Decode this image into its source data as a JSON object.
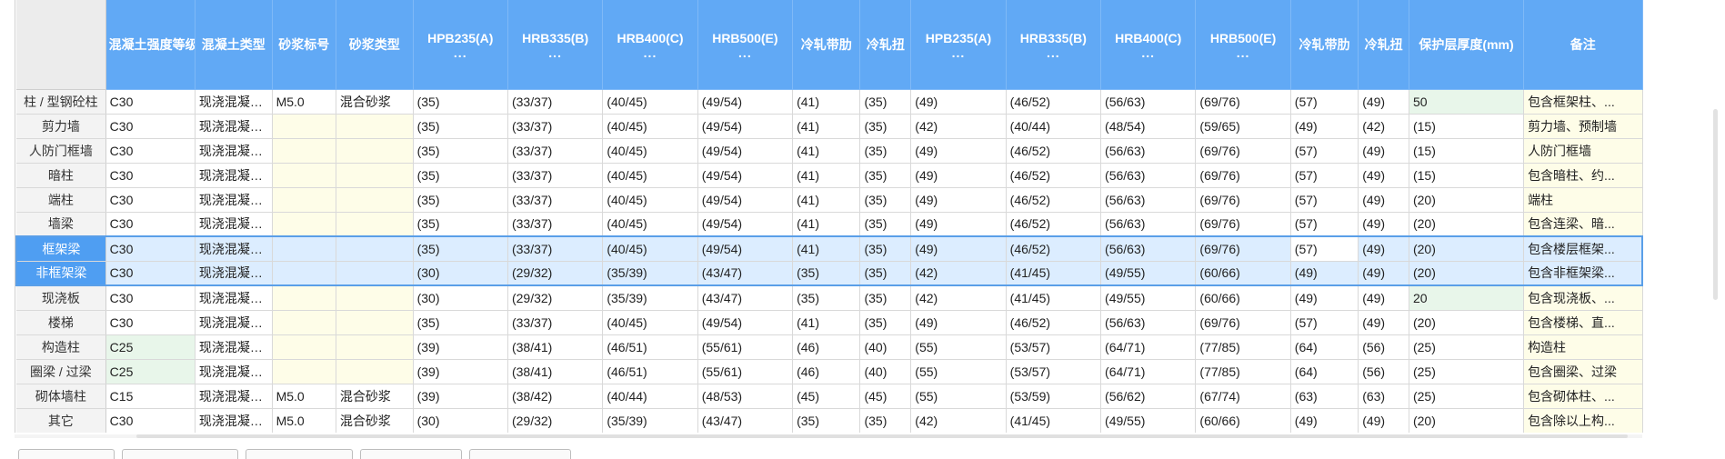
{
  "table": {
    "columns": [
      {
        "label": "混凝土强度等级",
        "dots": ""
      },
      {
        "label": "混凝土类型",
        "dots": ""
      },
      {
        "label": "砂浆标号",
        "dots": ""
      },
      {
        "label": "砂浆类型",
        "dots": ""
      },
      {
        "label": "HPB235(A)",
        "dots": "..."
      },
      {
        "label": "HRB335(B)",
        "dots": "..."
      },
      {
        "label": "HRB400(C)",
        "dots": "..."
      },
      {
        "label": "HRB500(E)",
        "dots": "..."
      },
      {
        "label": "冷轧带肋",
        "dots": ""
      },
      {
        "label": "冷轧扭",
        "dots": ""
      },
      {
        "label": "HPB235(A)",
        "dots": "..."
      },
      {
        "label": "HRB335(B)",
        "dots": "..."
      },
      {
        "label": "HRB400(C)",
        "dots": "..."
      },
      {
        "label": "HRB500(E)",
        "dots": "..."
      },
      {
        "label": "冷轧带肋",
        "dots": ""
      },
      {
        "label": "冷轧扭",
        "dots": ""
      },
      {
        "label": "保护层厚度(mm)",
        "dots": ""
      },
      {
        "label": "备注",
        "dots": ""
      }
    ],
    "rows": [
      {
        "name": "柱 / 型钢砼柱",
        "cells": [
          "C30",
          "现浇混凝土...",
          "M5.0",
          "混合砂浆",
          "(35)",
          "(33/37)",
          "(40/45)",
          "(49/54)",
          "(41)",
          "(35)",
          "(49)",
          "(46/52)",
          "(56/63)",
          "(69/76)",
          "(57)",
          "(49)",
          "50",
          "包含框架柱、..."
        ]
      },
      {
        "name": "剪力墙",
        "cells": [
          "C30",
          "现浇混凝土...",
          "",
          "",
          "(35)",
          "(33/37)",
          "(40/45)",
          "(49/54)",
          "(41)",
          "(35)",
          "(42)",
          "(40/44)",
          "(48/54)",
          "(59/65)",
          "(49)",
          "(42)",
          "(15)",
          "剪力墙、预制墙"
        ]
      },
      {
        "name": "人防门框墙",
        "cells": [
          "C30",
          "现浇混凝土...",
          "",
          "",
          "(35)",
          "(33/37)",
          "(40/45)",
          "(49/54)",
          "(41)",
          "(35)",
          "(49)",
          "(46/52)",
          "(56/63)",
          "(69/76)",
          "(57)",
          "(49)",
          "(15)",
          "人防门框墙"
        ]
      },
      {
        "name": "暗柱",
        "cells": [
          "C30",
          "现浇混凝土...",
          "",
          "",
          "(35)",
          "(33/37)",
          "(40/45)",
          "(49/54)",
          "(41)",
          "(35)",
          "(49)",
          "(46/52)",
          "(56/63)",
          "(69/76)",
          "(57)",
          "(49)",
          "(15)",
          "包含暗柱、约..."
        ]
      },
      {
        "name": "端柱",
        "cells": [
          "C30",
          "现浇混凝土...",
          "",
          "",
          "(35)",
          "(33/37)",
          "(40/45)",
          "(49/54)",
          "(41)",
          "(35)",
          "(49)",
          "(46/52)",
          "(56/63)",
          "(69/76)",
          "(57)",
          "(49)",
          "(20)",
          "端柱"
        ]
      },
      {
        "name": "墙梁",
        "cells": [
          "C30",
          "现浇混凝土...",
          "",
          "",
          "(35)",
          "(33/37)",
          "(40/45)",
          "(49/54)",
          "(41)",
          "(35)",
          "(49)",
          "(46/52)",
          "(56/63)",
          "(69/76)",
          "(57)",
          "(49)",
          "(20)",
          "包含连梁、暗..."
        ]
      },
      {
        "name": "框架梁",
        "cells": [
          "C30",
          "现浇混凝土...",
          "",
          "",
          "(35)",
          "(33/37)",
          "(40/45)",
          "(49/54)",
          "(41)",
          "(35)",
          "(49)",
          "(46/52)",
          "(56/63)",
          "(69/76)",
          "(57)",
          "(49)",
          "(20)",
          "包含楼层框架..."
        ]
      },
      {
        "name": "非框架梁",
        "cells": [
          "C30",
          "现浇混凝土...",
          "",
          "",
          "(30)",
          "(29/32)",
          "(35/39)",
          "(43/47)",
          "(35)",
          "(35)",
          "(42)",
          "(41/45)",
          "(49/55)",
          "(60/66)",
          "(49)",
          "(49)",
          "(20)",
          "包含非框架梁..."
        ]
      },
      {
        "name": "现浇板",
        "cells": [
          "C30",
          "现浇混凝土...",
          "",
          "",
          "(30)",
          "(29/32)",
          "(35/39)",
          "(43/47)",
          "(35)",
          "(35)",
          "(42)",
          "(41/45)",
          "(49/55)",
          "(60/66)",
          "(49)",
          "(49)",
          "20",
          "包含现浇板、..."
        ]
      },
      {
        "name": "楼梯",
        "cells": [
          "C30",
          "现浇混凝土...",
          "",
          "",
          "(35)",
          "(33/37)",
          "(40/45)",
          "(49/54)",
          "(41)",
          "(35)",
          "(49)",
          "(46/52)",
          "(56/63)",
          "(69/76)",
          "(57)",
          "(49)",
          "(20)",
          "包含楼梯、直..."
        ]
      },
      {
        "name": "构造柱",
        "cells": [
          "C25",
          "现浇混凝土...",
          "",
          "",
          "(39)",
          "(38/41)",
          "(46/51)",
          "(55/61)",
          "(46)",
          "(40)",
          "(55)",
          "(53/57)",
          "(64/71)",
          "(77/85)",
          "(64)",
          "(56)",
          "(25)",
          "构造柱"
        ]
      },
      {
        "name": "圈梁 / 过梁",
        "cells": [
          "C25",
          "现浇混凝土...",
          "",
          "",
          "(39)",
          "(38/41)",
          "(46/51)",
          "(55/61)",
          "(46)",
          "(40)",
          "(55)",
          "(53/57)",
          "(64/71)",
          "(77/85)",
          "(64)",
          "(56)",
          "(25)",
          "包含圈梁、过梁"
        ]
      },
      {
        "name": "砌体墙柱",
        "cells": [
          "C15",
          "现浇混凝土...",
          "M5.0",
          "混合砂浆",
          "(39)",
          "(38/42)",
          "(40/44)",
          "(48/53)",
          "(45)",
          "(45)",
          "(55)",
          "(53/59)",
          "(56/62)",
          "(67/74)",
          "(63)",
          "(63)",
          "(25)",
          "包含砌体柱、..."
        ]
      },
      {
        "name": "其它",
        "cells": [
          "C30",
          "现浇混凝土...",
          "M5.0",
          "混合砂浆",
          "(30)",
          "(29/32)",
          "(35/39)",
          "(43/47)",
          "(35)",
          "(35)",
          "(42)",
          "(41/45)",
          "(49/55)",
          "(60/66)",
          "(49)",
          "(49)",
          "(20)",
          "包含除以上构..."
        ]
      }
    ]
  }
}
